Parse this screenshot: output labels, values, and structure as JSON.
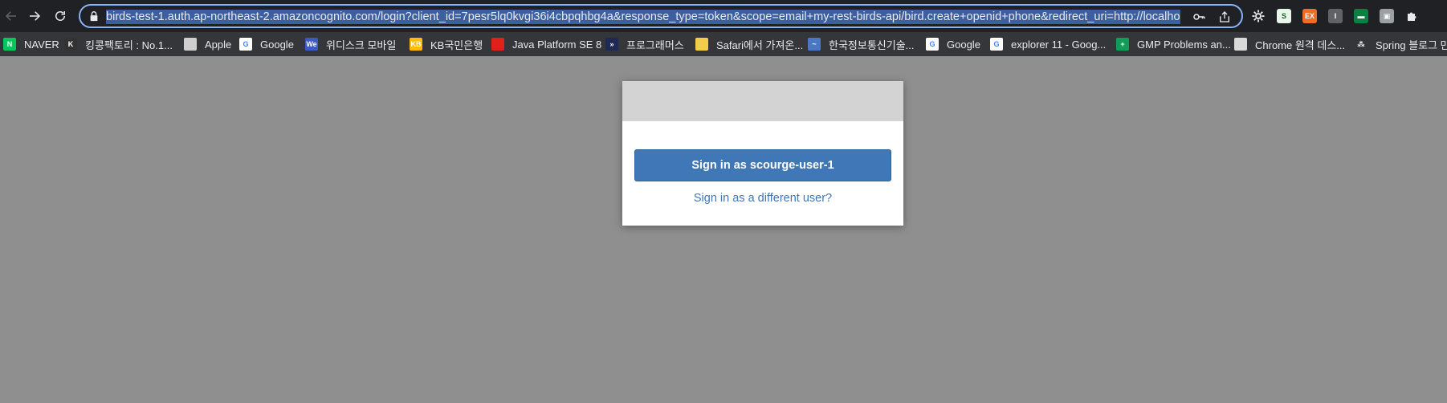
{
  "browser": {
    "address_url": "birds-test-1.auth.ap-northeast-2.amazoncognito.com/login?client_id=7pesr5lq0kvgi36i4cbpqhbg4a&response_type=token&scope=email+my-rest-birds-api/bird.create+openid+phone&redirect_uri=http://localhos",
    "toolbar_icons": [
      "back-arrow-icon",
      "forward-arrow-icon",
      "reload-icon",
      "lock-icon",
      "key-icon",
      "share-icon",
      "gear-icon",
      "puzzle-icon"
    ],
    "accent_color": "#8ab4f8"
  },
  "bookmarks": [
    {
      "label": "NAVER",
      "icon": "naver-icon",
      "color": "#03c75a",
      "glyph": "N"
    },
    {
      "label": "킹콩팩토리 : No.1...",
      "icon": "kingkong-icon",
      "color": "#333333",
      "glyph": "K"
    },
    {
      "label": "Apple",
      "icon": "apple-icon",
      "color": "#cfcfcf",
      "glyph": ""
    },
    {
      "label": "Google",
      "icon": "google-icon",
      "color": "#ffffff",
      "glyph": "G"
    },
    {
      "label": "위디스크 모바일",
      "icon": "wedisk-icon",
      "color": "#3b5bc4",
      "glyph": "We"
    },
    {
      "label": "KB국민은행",
      "icon": "kb-icon",
      "color": "#ffbc00",
      "glyph": "KB"
    },
    {
      "label": "Java Platform SE 8",
      "icon": "oracle-icon",
      "color": "#e0201b",
      "glyph": ""
    },
    {
      "label": "프로그래머스",
      "icon": "programmers-icon",
      "color": "#1e2a55",
      "glyph": "»"
    },
    {
      "label": "Safari에서 가져온...",
      "icon": "folder-icon",
      "color": "#f5cc4a",
      "glyph": ""
    },
    {
      "label": "한국정보통신기술...",
      "icon": "tta-icon",
      "color": "#4a78c4",
      "glyph": "~"
    },
    {
      "label": "Google",
      "icon": "google-icon",
      "color": "#ffffff",
      "glyph": "G"
    },
    {
      "label": "explorer 11 - Goog...",
      "icon": "google-icon",
      "color": "#ffffff",
      "glyph": "G"
    },
    {
      "label": "GMP Problems an...",
      "icon": "sheets-icon",
      "color": "#0f9d58",
      "glyph": "+"
    },
    {
      "label": "Chrome 원격 데스...",
      "icon": "remote-desktop-icon",
      "color": "#d9d9d9",
      "glyph": ""
    },
    {
      "label": "Spring 블로그 만",
      "icon": "spring-icon",
      "color": "#35363a",
      "glyph": "⁂"
    }
  ],
  "login": {
    "signin_label": "Sign in as scourge-user-1",
    "different_user_label": "Sign in as a different user?",
    "button_color": "#3f77b7"
  }
}
